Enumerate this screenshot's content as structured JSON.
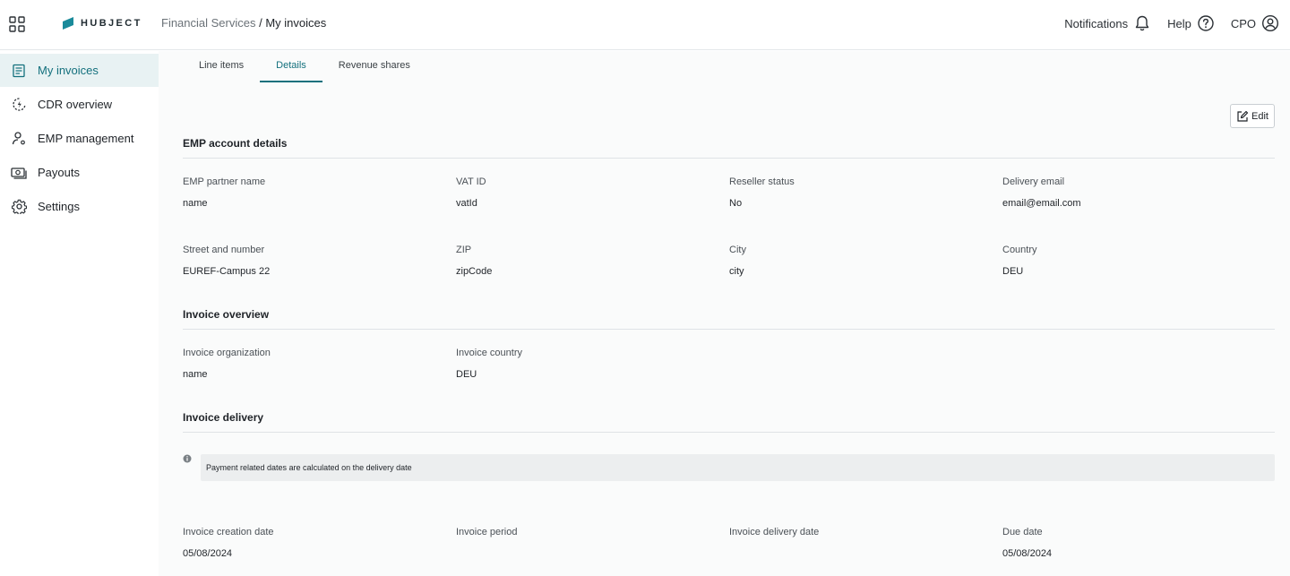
{
  "header": {
    "logo_text": "HUBJECT",
    "breadcrumb": {
      "parent": "Financial Services",
      "separator": " / ",
      "current": "My invoices"
    },
    "notifications_label": "Notifications",
    "help_label": "Help",
    "user_label": "CPO"
  },
  "sidebar": {
    "items": [
      {
        "label": "My invoices",
        "icon": "document-list-icon",
        "active": true
      },
      {
        "label": "CDR overview",
        "icon": "charging-cycle-icon",
        "active": false
      },
      {
        "label": "EMP management",
        "icon": "user-settings-icon",
        "active": false
      },
      {
        "label": "Payouts",
        "icon": "cash-icon",
        "active": false
      },
      {
        "label": "Settings",
        "icon": "gear-icon",
        "active": false
      }
    ]
  },
  "tabs": [
    {
      "label": "Line items",
      "active": false
    },
    {
      "label": "Details",
      "active": true
    },
    {
      "label": "Revenue shares",
      "active": false
    }
  ],
  "edit_label": "Edit",
  "emp_account": {
    "title": "EMP account details",
    "row1": [
      {
        "label": "EMP partner name",
        "value": "name"
      },
      {
        "label": "VAT ID",
        "value": "vatId"
      },
      {
        "label": "Reseller status",
        "value": "No"
      },
      {
        "label": "Delivery email",
        "value": "email@email.com"
      }
    ],
    "row2": [
      {
        "label": "Street and number",
        "value": "EUREF-Campus 22"
      },
      {
        "label": "ZIP",
        "value": "zipCode"
      },
      {
        "label": "City",
        "value": "city"
      },
      {
        "label": "Country",
        "value": "DEU"
      }
    ]
  },
  "invoice_overview": {
    "title": "Invoice overview",
    "row1": [
      {
        "label": "Invoice organization",
        "value": "name"
      },
      {
        "label": "Invoice country",
        "value": "DEU"
      }
    ]
  },
  "invoice_delivery": {
    "title": "Invoice delivery",
    "info": "Payment related dates are calculated on the delivery date",
    "row1": [
      {
        "label": "Invoice creation date",
        "value": "05/08/2024"
      },
      {
        "label": "Invoice period",
        "value": ""
      },
      {
        "label": "Invoice delivery date",
        "value": ""
      },
      {
        "label": "Due date",
        "value": "05/08/2024"
      }
    ]
  },
  "colors": {
    "accent": "#13707d",
    "active_bg": "#e8f2f3",
    "logo": "#1a8a9a"
  }
}
